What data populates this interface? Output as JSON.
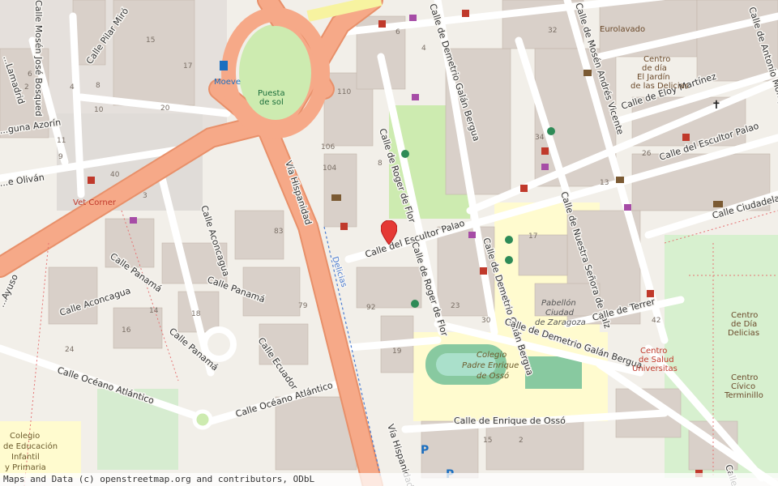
{
  "streets": {
    "escultor_palao_w": "Calle del Escultor Palao",
    "escultor_palao_e": "Calle del Escultor Palao",
    "demetrio_n": "Calle de Demetrio Galán Bergua",
    "demetrio_s": "Calle de Demetrio Galán Bergua",
    "demetrio_s2": "Calle de Demetrio Galán Bergua",
    "roger_n": "Calle de Roger de Flor",
    "roger_s": "Calle de Roger de Flor",
    "mosen_andres": "Calle de Mosén Andrés Vicente",
    "nuestra_senora": "Calle de Nuestra Señora de Salz",
    "eloy": "Calle de Eloy Martínez",
    "ciudadela": "Calle Ciudadela",
    "terrer": "Calle de Terrer",
    "enrique_osso": "Calle de Enrique de Ossó",
    "oceano_1": "Calle Océano Atlántico",
    "oceano_2": "Calle Océano Atlántico",
    "via_hisp_1": "Vía Hispanidad",
    "via_hisp_2": "Vía Hispanidad",
    "delicias": "Delicias",
    "panama_1": "Calle Panamá",
    "panama_2": "Calle Panamá",
    "panama_3": "Calle Panamá",
    "aconcagua_1": "Calle Aconcagua",
    "aconcagua_2": "Calle Aconcagua",
    "ecuador": "Calle Ecuador",
    "pilar_miro": "Calle Pilar Miró",
    "mosen_bosqued": "Calle Mosén José Bosqued",
    "laguna": "...guna Azorín",
    "olivan": "...e Oliván",
    "lamadrid": "...Lamadrid",
    "ayuso": "...Ayuso",
    "antonio": "Calle de Antonio Mompeón",
    "calle_x": "Calle"
  },
  "pois": {
    "moeve": "Moeve",
    "puesta_l1": "Puesta",
    "puesta_l2": "de sol",
    "vet": "Vet Corner",
    "eurolavado": "Eurolavado",
    "centro_jardin_l1": "Centro",
    "centro_jardin_l2": "de día",
    "centro_jardin_l3": "El Jardín",
    "centro_jardin_l4": "de las Delicias",
    "pabellon_l1": "Pabellón",
    "pabellon_l2": "Ciudad",
    "pabellon_l3": "de Zaragoza",
    "colegio_osso_l1": "Colegio",
    "colegio_osso_l2": "Padre Enrique",
    "colegio_osso_l3": "de Ossó",
    "centro_salud_l1": "Centro",
    "centro_salud_l2": "de Salud",
    "centro_salud_l3": "Universitas",
    "centro_dia_l1": "Centro",
    "centro_dia_l2": "de Día",
    "centro_dia_l3": "Delicias",
    "centro_civico_l1": "Centro",
    "centro_civico_l2": "Cívico",
    "centro_civico_l3": "Terminillo",
    "colegio_edu_l1": "Colegio",
    "colegio_edu_l2": "de Educación",
    "colegio_edu_l3": "Infantil",
    "colegio_edu_l4": "y Primaria"
  },
  "house_numbers": {
    "n1": "15",
    "n2": "17",
    "n3": "20",
    "n4": "8",
    "n5": "10",
    "n6": "6",
    "n7": "2",
    "n8": "4",
    "n9": "11",
    "n10": "9",
    "n11": "40",
    "n12": "3",
    "n13": "83",
    "n14": "110",
    "n15": "106",
    "n16": "104",
    "n17": "8",
    "n18": "6",
    "n19": "4",
    "n20": "32",
    "n21": "34",
    "n22": "26",
    "n23": "13",
    "n24": "17",
    "n25": "23",
    "n26": "30",
    "n27": "92",
    "n28": "42",
    "n29": "79",
    "n30": "24",
    "n31": "14",
    "n32": "16",
    "n33": "18",
    "n34": "19",
    "n35": "15",
    "n36": "2"
  },
  "attribution": "Maps and Data (c) openstreetmap.org and contributors, ODbL",
  "colors": {
    "background": "#f2efe9",
    "building": "#d9d0c9",
    "major_road": "#f4a582",
    "park": "#c8facc",
    "school": "#fffbcf",
    "marker": "#e53935"
  }
}
